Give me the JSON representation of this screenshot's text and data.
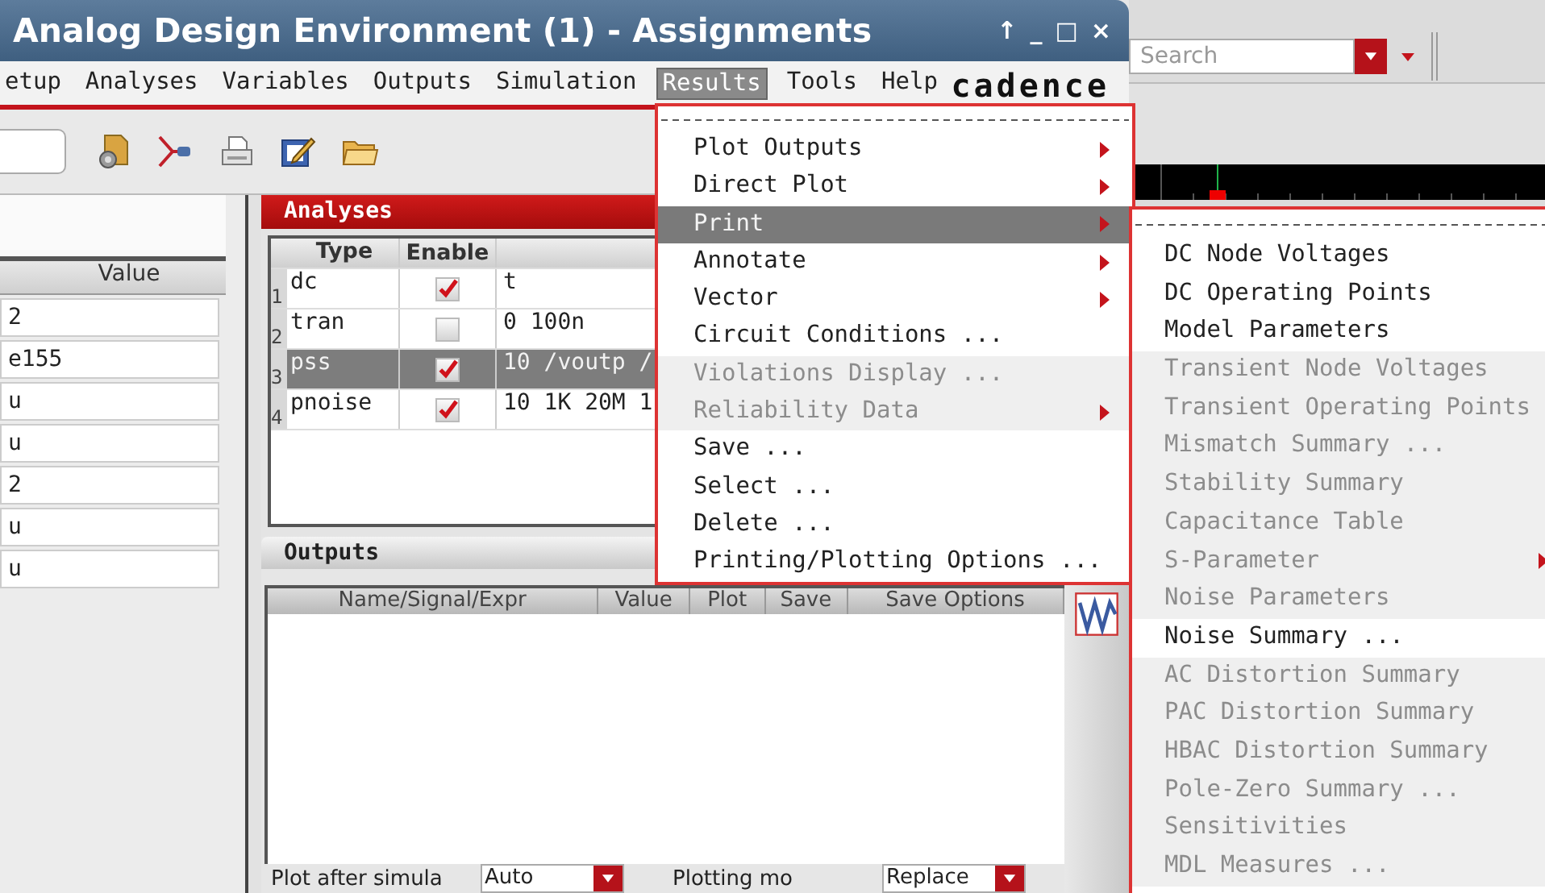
{
  "window": {
    "title": "Analog Design Environment (1) - Assignments",
    "controls": [
      "↑",
      "_",
      "□",
      "×"
    ]
  },
  "menubar": [
    {
      "label": "etup",
      "selected": false
    },
    {
      "label": "Analyses",
      "selected": false
    },
    {
      "label": "Variables",
      "selected": false
    },
    {
      "label": "Outputs",
      "selected": false
    },
    {
      "label": "Simulation",
      "selected": false
    },
    {
      "label": "Results",
      "selected": true
    },
    {
      "label": "Tools",
      "selected": false
    },
    {
      "label": "Help",
      "selected": false
    }
  ],
  "logo": "cadence",
  "background_window": {
    "search": {
      "placeholder": "Search"
    }
  },
  "variables_table": {
    "columns": [
      "Value"
    ],
    "rows": [
      "2",
      "e155",
      "u",
      "u",
      "2",
      "u",
      "u"
    ]
  },
  "analyses": {
    "title": "Analyses",
    "columns": [
      "Type",
      "Enable"
    ],
    "rows": [
      {
        "index": "1",
        "type": "dc",
        "enabled": true,
        "arguments": "t",
        "selected": false
      },
      {
        "index": "2",
        "type": "tran",
        "enabled": false,
        "arguments": "0 100n",
        "selected": false
      },
      {
        "index": "3",
        "type": "pss",
        "enabled": true,
        "arguments": "10 /voutp /",
        "selected": true
      },
      {
        "index": "4",
        "type": "pnoise",
        "enabled": true,
        "arguments": "10 1K 20M 1",
        "selected": false
      }
    ]
  },
  "outputs": {
    "title": "Outputs",
    "columns": [
      "Name/Signal/Expr",
      "Value",
      "Plot",
      "Save",
      "Save Options"
    ]
  },
  "plot_options": [
    {
      "label": "Plot after simula",
      "value": "Auto"
    },
    {
      "label": "Plotting mo",
      "value": "Replace"
    }
  ],
  "results_menu": {
    "items": [
      {
        "label": "Plot Outputs",
        "submenu": true,
        "disabled": false,
        "selected": false
      },
      {
        "label": "Direct Plot",
        "submenu": true,
        "disabled": false,
        "selected": false
      },
      {
        "label": "Print",
        "submenu": true,
        "disabled": false,
        "selected": true
      },
      {
        "label": "Annotate",
        "submenu": true,
        "disabled": false,
        "selected": false
      },
      {
        "label": "Vector",
        "submenu": true,
        "disabled": false,
        "selected": false
      },
      {
        "label": "Circuit Conditions ...",
        "submenu": false,
        "disabled": false,
        "selected": false
      },
      {
        "label": "Violations Display ...",
        "submenu": false,
        "disabled": true,
        "selected": false
      },
      {
        "label": "Reliability Data",
        "submenu": true,
        "disabled": true,
        "selected": false
      },
      {
        "label": "Save ...",
        "submenu": false,
        "disabled": false,
        "selected": false
      },
      {
        "label": "Select ...",
        "submenu": false,
        "disabled": false,
        "selected": false
      },
      {
        "label": "Delete ...",
        "submenu": false,
        "disabled": false,
        "selected": false
      },
      {
        "label": "Printing/Plotting Options ...",
        "submenu": false,
        "disabled": false,
        "selected": false
      }
    ]
  },
  "print_submenu": {
    "items": [
      {
        "label": "DC Node Voltages",
        "submenu": false,
        "disabled": false
      },
      {
        "label": "DC Operating Points",
        "submenu": false,
        "disabled": false
      },
      {
        "label": "Model Parameters",
        "submenu": false,
        "disabled": false
      },
      {
        "label": "Transient Node Voltages",
        "submenu": false,
        "disabled": true
      },
      {
        "label": "Transient Operating Points",
        "submenu": false,
        "disabled": true
      },
      {
        "label": "Mismatch Summary ...",
        "submenu": false,
        "disabled": true
      },
      {
        "label": "Stability Summary",
        "submenu": false,
        "disabled": true
      },
      {
        "label": "Capacitance Table",
        "submenu": false,
        "disabled": true
      },
      {
        "label": "S-Parameter",
        "submenu": true,
        "disabled": true
      },
      {
        "label": "Noise Parameters",
        "submenu": false,
        "disabled": true
      },
      {
        "label": "Noise Summary ...",
        "submenu": false,
        "disabled": false
      },
      {
        "label": "AC Distortion Summary",
        "submenu": false,
        "disabled": true
      },
      {
        "label": "PAC Distortion Summary",
        "submenu": false,
        "disabled": true
      },
      {
        "label": "HBAC Distortion Summary",
        "submenu": false,
        "disabled": true
      },
      {
        "label": "Pole-Zero Summary ...",
        "submenu": false,
        "disabled": true
      },
      {
        "label": "Sensitivities",
        "submenu": false,
        "disabled": true
      },
      {
        "label": "MDL Measures ...",
        "submenu": false,
        "disabled": true
      }
    ]
  }
}
